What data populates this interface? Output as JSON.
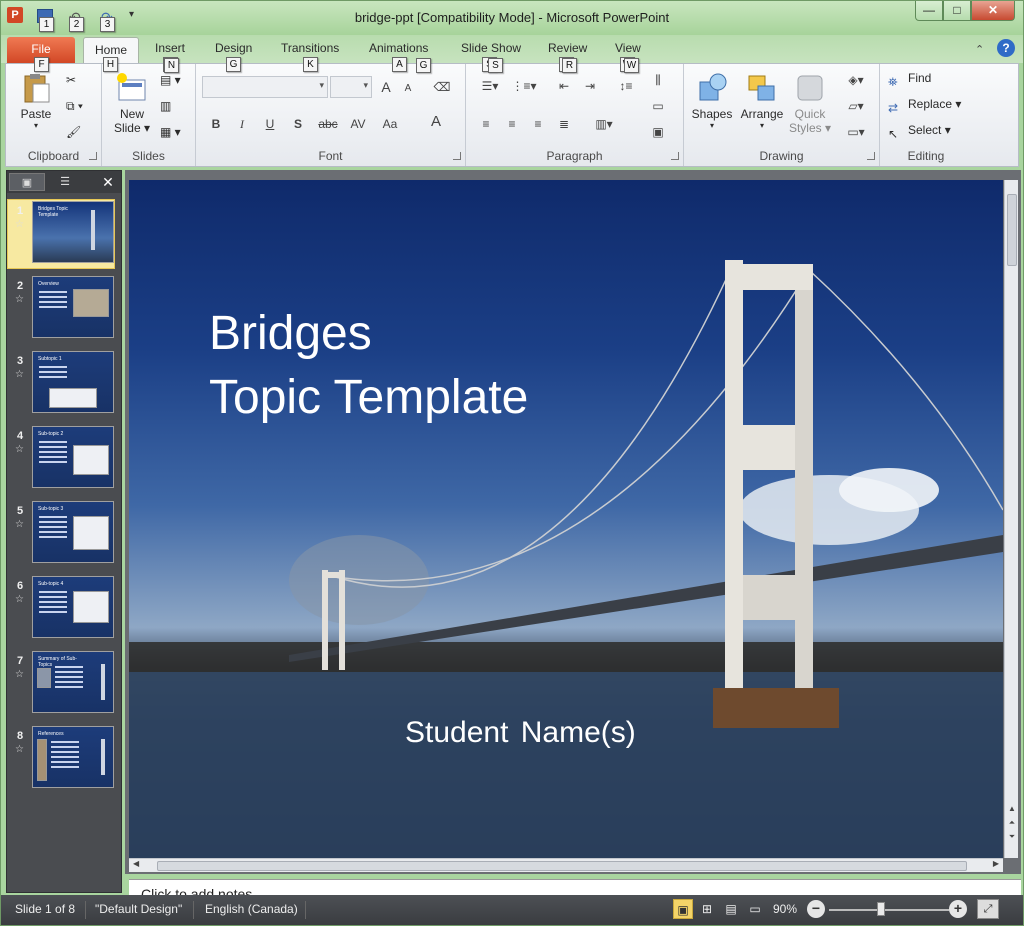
{
  "window": {
    "title": "bridge-ppt [Compatibility Mode]  -  Microsoft PowerPoint",
    "app_icon": "P",
    "controls": {
      "minimize": "—",
      "maximize": "□",
      "close": "✕"
    }
  },
  "quick_access": {
    "keytips": [
      "1",
      "2",
      "3"
    ]
  },
  "tabs": [
    {
      "label": "File",
      "keytip": "F"
    },
    {
      "label": "Home",
      "keytip": "H"
    },
    {
      "label": "Insert",
      "keytip": "N"
    },
    {
      "label": "Design",
      "keytip": "G"
    },
    {
      "label": "Transitions",
      "keytip": "K"
    },
    {
      "label": "Animations",
      "keytip": "A"
    },
    {
      "label": "Slide Show",
      "keytip": "S"
    },
    {
      "label": "Review",
      "keytip": "R"
    },
    {
      "label": "View",
      "keytip": "W"
    }
  ],
  "ribbon": {
    "clipboard": {
      "label": "Clipboard",
      "paste": "Paste"
    },
    "slides": {
      "label": "Slides",
      "new_slide_1": "New",
      "new_slide_2": "Slide ▾"
    },
    "font": {
      "label": "Font",
      "bold": "B",
      "italic": "I",
      "underline": "U",
      "shadow": "S",
      "strike": "abc",
      "spacing": "AV",
      "case": "Aa",
      "color": "A",
      "grow": "A",
      "shrink": "A"
    },
    "paragraph": {
      "label": "Paragraph"
    },
    "drawing": {
      "label": "Drawing",
      "shapes": "Shapes",
      "arrange": "Arrange",
      "quick_styles_1": "Quick",
      "quick_styles_2": "Styles ▾"
    },
    "editing": {
      "label": "Editing",
      "find": "Find",
      "replace": "Replace",
      "select": "Select"
    }
  },
  "panel": {
    "close": "✕"
  },
  "slides": [
    {
      "num": "1",
      "title": "Bridges Topic Template"
    },
    {
      "num": "2",
      "title": "Overview"
    },
    {
      "num": "3",
      "title": "Subtopic 1"
    },
    {
      "num": "4",
      "title": "Sub-topic 2"
    },
    {
      "num": "5",
      "title": "Sub-topic 3"
    },
    {
      "num": "6",
      "title": "Sub-topic 4"
    },
    {
      "num": "7",
      "title": "Summary of Sub-Topics"
    },
    {
      "num": "8",
      "title": "References"
    }
  ],
  "slide": {
    "title_line1": "Bridges",
    "title_line2": "Topic Template",
    "subtitle": "Student  Name(s)"
  },
  "notes": {
    "placeholder": "Click to add notes"
  },
  "status": {
    "slide_of": "Slide 1 of 8",
    "theme": "\"Default Design\"",
    "language": "English (Canada)",
    "zoom": "90%"
  }
}
